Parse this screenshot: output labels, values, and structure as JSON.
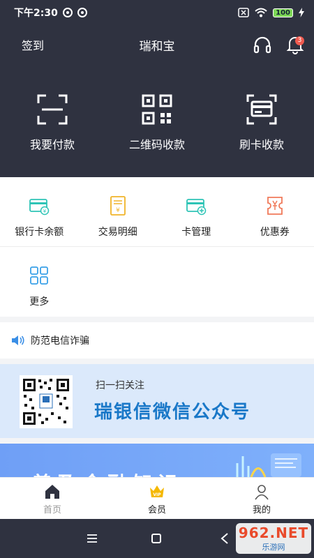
{
  "status_bar": {
    "time": "下午2:30",
    "battery": "100"
  },
  "header": {
    "signin": "签到",
    "title": "瑞和宝",
    "notification_count": "3"
  },
  "payments": [
    {
      "label": "我要付款",
      "icon": "scan-frame-icon"
    },
    {
      "label": "二维码收款",
      "icon": "qr-code-icon"
    },
    {
      "label": "刷卡收款",
      "icon": "card-swipe-icon"
    }
  ],
  "services": [
    {
      "label": "银行卡余额",
      "icon": "card-balance-icon",
      "color": "#2ec4b6"
    },
    {
      "label": "交易明细",
      "icon": "receipt-icon",
      "color": "#f0b429"
    },
    {
      "label": "卡管理",
      "icon": "card-manage-icon",
      "color": "#2ec4b6"
    },
    {
      "label": "优惠券",
      "icon": "coupon-icon",
      "color": "#f07a5a"
    },
    {
      "label": "更多",
      "icon": "more-grid-icon",
      "color": "#3aa0e8"
    }
  ],
  "notice": {
    "text": "防范电信诈骗"
  },
  "banner_wechat": {
    "subtitle": "扫一扫关注",
    "title": "瑞银信微信公众号"
  },
  "banner_knowledge": {
    "title": "普及金融知识"
  },
  "tabbar": [
    {
      "label": "首页"
    },
    {
      "label": "会员"
    },
    {
      "label": "我的"
    }
  ],
  "watermark": {
    "line1": "962.NET",
    "line2": "乐游网"
  }
}
